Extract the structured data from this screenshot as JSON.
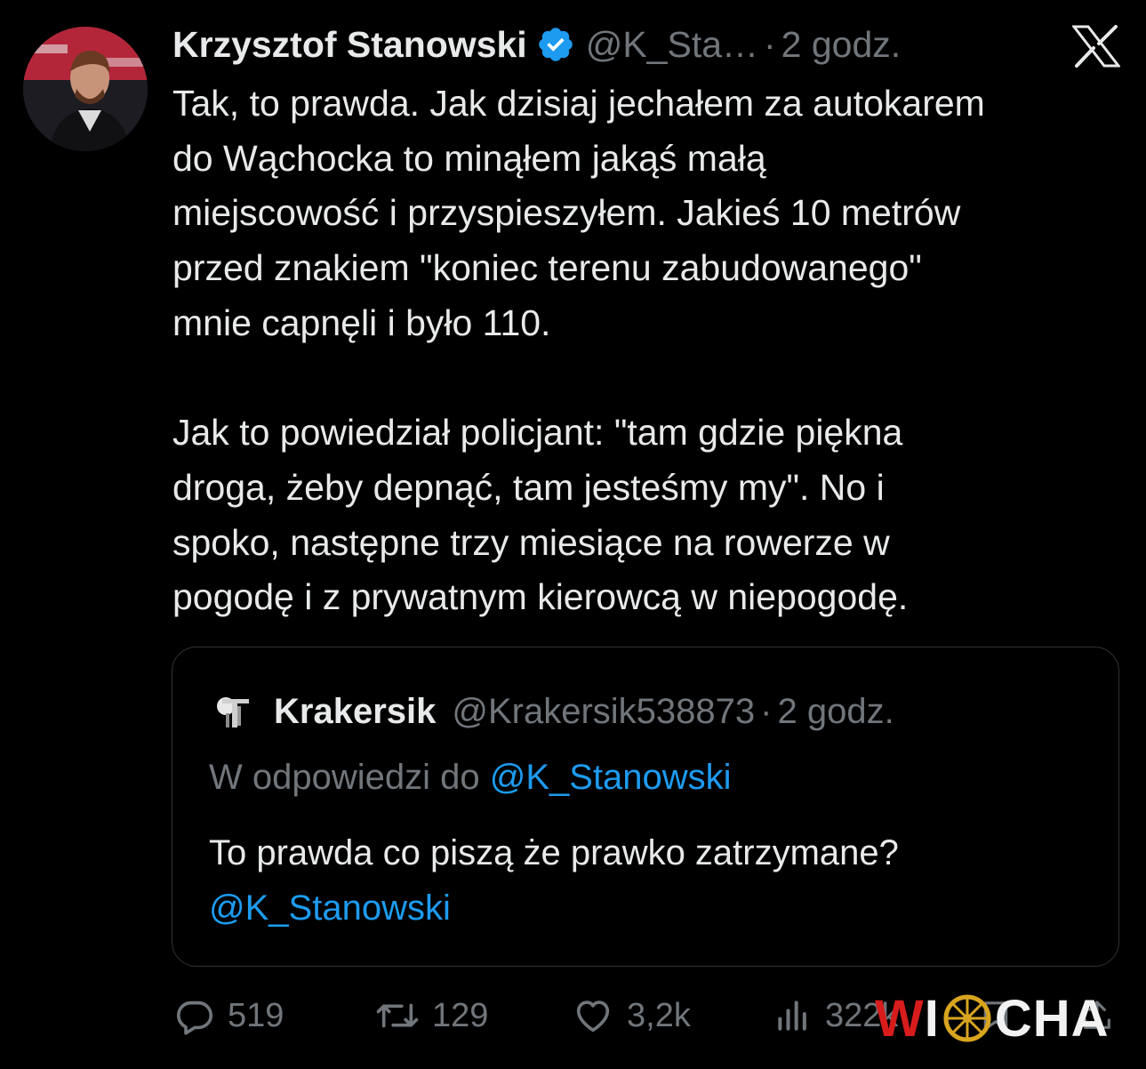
{
  "tweet": {
    "author_name": "Krzysztof Stanowski",
    "handle": "@K_Sta…",
    "separator": "·",
    "time": "2 godz.",
    "verified_color": "#1d9bf0",
    "text": "Tak, to prawda. Jak dzisiaj jechałem za autokarem\ndo Wąchocka to minąłem jakąś małą\nmiejscowość i przyspieszyłem. Jakieś 10 metrów\nprzed znakiem \"koniec terenu zabudowanego\"\nmnie capnęli i było 110.\n\nJak to powiedział policjant: \"tam gdzie piękna\ndroga, żeby depnąć, tam jesteśmy my\". No i\nspoko, następne trzy miesiące na rowerze w\npogodę i z prywatnym kierowcą w niepogodę."
  },
  "quote": {
    "author_name": "Krakersik",
    "handle": "@Krakersik538873",
    "separator": "·",
    "time": "2 godz.",
    "reply_prefix": "W odpowiedzi do",
    "reply_mention": "@K_Stanowski",
    "text": "To prawda co piszą że prawko zatrzymane?",
    "text_mention": "@K_Stanowski"
  },
  "actions": {
    "replies": "519",
    "retweets": "129",
    "likes": "3,2k",
    "views": "322k"
  },
  "watermark": {
    "red_part": "W",
    "white_part_1": "I",
    "white_part_2": "CHA"
  },
  "colors": {
    "background": "#000000",
    "text": "#e7e9ea",
    "secondary": "#71767b",
    "link": "#1d9bf0",
    "border": "#2f3336"
  }
}
